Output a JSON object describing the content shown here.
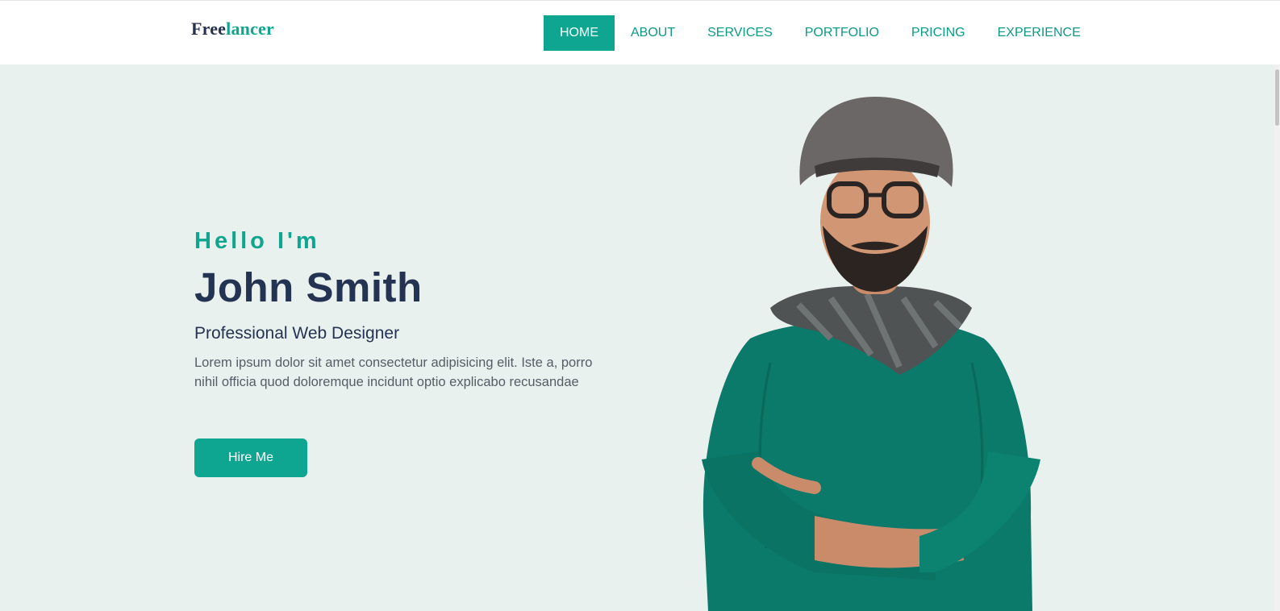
{
  "logo": {
    "part1": "Free",
    "part2": "lancer"
  },
  "nav": {
    "items": [
      "HOME",
      "ABOUT",
      "SERVICES",
      "PORTFOLIO",
      "PRICING",
      "EXPERIENCE"
    ],
    "active": "HOME"
  },
  "hero": {
    "greeting": "Hello I'm",
    "name": "John Smith",
    "role": "Professional Web Designer",
    "description": "Lorem ipsum dolor sit amet consectetur adipisicing elit. Iste a, porro nihil officia quod doloremque incidunt optio explicabo recusandae",
    "cta_label": "Hire Me"
  },
  "colors": {
    "accent": "#0ea591",
    "heading": "#253352",
    "hero_bg": "#e9f1ef",
    "body_text": "#555d66"
  }
}
